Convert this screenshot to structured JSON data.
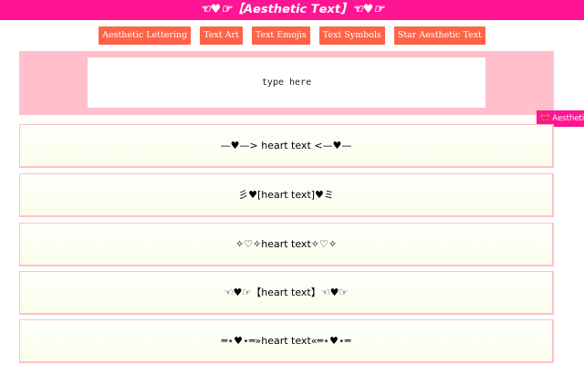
{
  "header": {
    "title": "☜♥☞【𝘼𝙚𝙨𝙩𝙝𝙚𝙩𝙞𝙘 𝙏𝙚𝙭𝙩】☜♥☞"
  },
  "nav": {
    "items": [
      {
        "label": "Aesthetic Lettering"
      },
      {
        "label": "Text Art"
      },
      {
        "label": "Text Emojis"
      },
      {
        "label": "Text Symbols"
      },
      {
        "label": "Star Aesthetic Text"
      }
    ]
  },
  "input": {
    "placeholder": "type here",
    "value": ""
  },
  "side_tab": {
    "label": "🎀 Aesthetic S"
  },
  "results": [
    {
      "text": "—♥—> heart text <—♥—"
    },
    {
      "text": "彡♥[heart text]♥ミ"
    },
    {
      "text": "✧♡✧heart text✧♡✧"
    },
    {
      "text": "☜♥☞【heart text】☜♥☞"
    },
    {
      "text": "═⋆♥⋆═»heart text«═⋆♥⋆═"
    }
  ],
  "colors": {
    "header_bg": "#ff1493",
    "nav_button_bg": "#ff6347",
    "input_panel_bg": "#ffc0cb",
    "row_border": "#ffc0cb",
    "row_bg_bottom": "#fafde8"
  }
}
